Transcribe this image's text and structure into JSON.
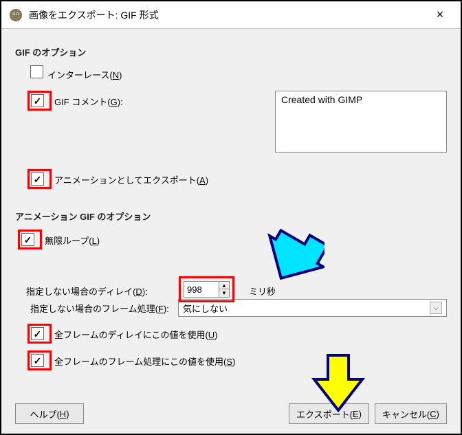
{
  "titlebar": {
    "title": "画像をエクスポート: GIF 形式",
    "close": "×"
  },
  "gifOptions": {
    "title": "GIF のオプション",
    "interlace": "インターレース(N)",
    "gifComment": "GIF コメント(G):",
    "commentValue": "Created with GIMP",
    "exportAsAnimation": "アニメーションとしてエクスポート(A)"
  },
  "animOptions": {
    "title": "アニメーション GIF のオプション",
    "infiniteLoop": "無限ループ(L)",
    "delayLabel": "指定しない場合のディレイ(D):",
    "delayValue": "998",
    "delayUnit": "ミリ秒",
    "frameDisposalLabel": "指定しない場合のフレーム処理(F):",
    "frameDisposalValue": "気にしない",
    "useDelayAll": "全フレームのディレイにこの値を使用(U)",
    "useDisposalAll": "全フレームのフレーム処理にこの値を使用(S)"
  },
  "buttons": {
    "help": "ヘルプ(H)",
    "export": "エクスポート(E)",
    "cancel": "キャンセル(C)"
  },
  "colors": {
    "highlight": "#ff0000",
    "arrowCyan": "#00e4ff",
    "arrowYellow": "#ffff00",
    "arrowStroke": "#000080"
  }
}
